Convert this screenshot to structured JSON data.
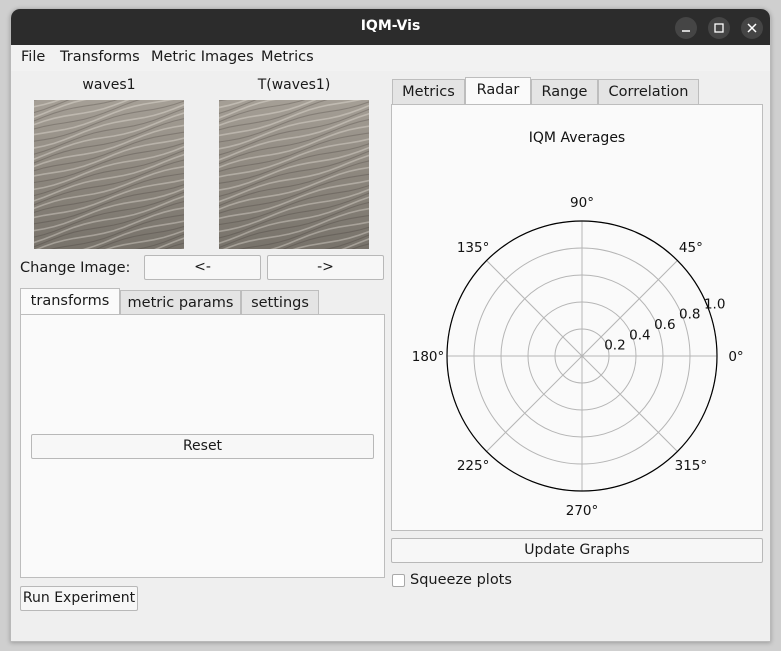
{
  "window": {
    "title": "IQM-Vis"
  },
  "menu": [
    "File",
    "Transforms",
    "Metric Images",
    "Metrics"
  ],
  "images": {
    "left_label": "waves1",
    "right_label": "T(waves1)"
  },
  "change_image": {
    "label": "Change Image:",
    "prev": "<-",
    "next": "->"
  },
  "left_tabs": [
    "transforms",
    "metric params",
    "settings"
  ],
  "left_active_tab": "transforms",
  "reset_label": "Reset",
  "run_experiment_label": "Run Experiment",
  "right_tabs": [
    "Metrics",
    "Radar",
    "Range",
    "Correlation"
  ],
  "right_active_tab": "Radar",
  "update_graphs_label": "Update Graphs",
  "squeeze": {
    "label": "Squeeze plots",
    "checked": false
  },
  "chart_data": {
    "type": "radar",
    "title": "IQM Averages",
    "angle_labels": [
      "0°",
      "45°",
      "90°",
      "135°",
      "180°",
      "225°",
      "270°",
      "315°"
    ],
    "radial_labels": [
      "0.2",
      "0.4",
      "0.6",
      "0.8",
      "1.0"
    ],
    "rlim": [
      0,
      1.0
    ],
    "grid": true,
    "series": []
  }
}
